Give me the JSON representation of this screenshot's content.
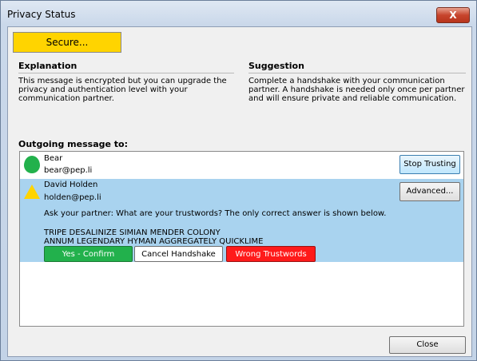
{
  "window": {
    "title": "Privacy Status",
    "close_glyph": "X"
  },
  "status": {
    "label": "Secure...",
    "color": "#ffd400"
  },
  "explanation": {
    "heading": "Explanation",
    "text": "This message is encrypted but you can upgrade the privacy and authentication level with your communication partner."
  },
  "suggestion": {
    "heading": "Suggestion",
    "text": "Complete a handshake with your communication partner. A handshake is needed only once per partner and will ensure private and reliable communication."
  },
  "outgoing": {
    "label": "Outgoing message to:"
  },
  "recipients": [
    {
      "name": "Bear",
      "email": "bear@pep.li",
      "status_icon": "green-shield-icon",
      "button": "Stop Trusting"
    },
    {
      "name": "David Holden",
      "email": "holden@pep.li",
      "status_icon": "yellow-triangle-icon",
      "button": "Advanced..."
    }
  ],
  "handshake": {
    "prompt": "Ask your partner: What are your trustwords? The only correct answer is shown below.",
    "trustwords_line1": "TRIPE DESALINIZE SIMIAN MENDER COLONY",
    "trustwords_line2": "ANNUM LEGENDARY HYMAN AGGREGATELY QUICKLIME",
    "yes_label": "Yes - Confirm",
    "cancel_label": "Cancel Handshake",
    "wrong_label": "Wrong Trustwords"
  },
  "footer": {
    "close_label": "Close"
  },
  "colors": {
    "accent_green": "#22b14c",
    "accent_red": "#ff1a1a",
    "selection_blue": "#a9d3ef"
  }
}
